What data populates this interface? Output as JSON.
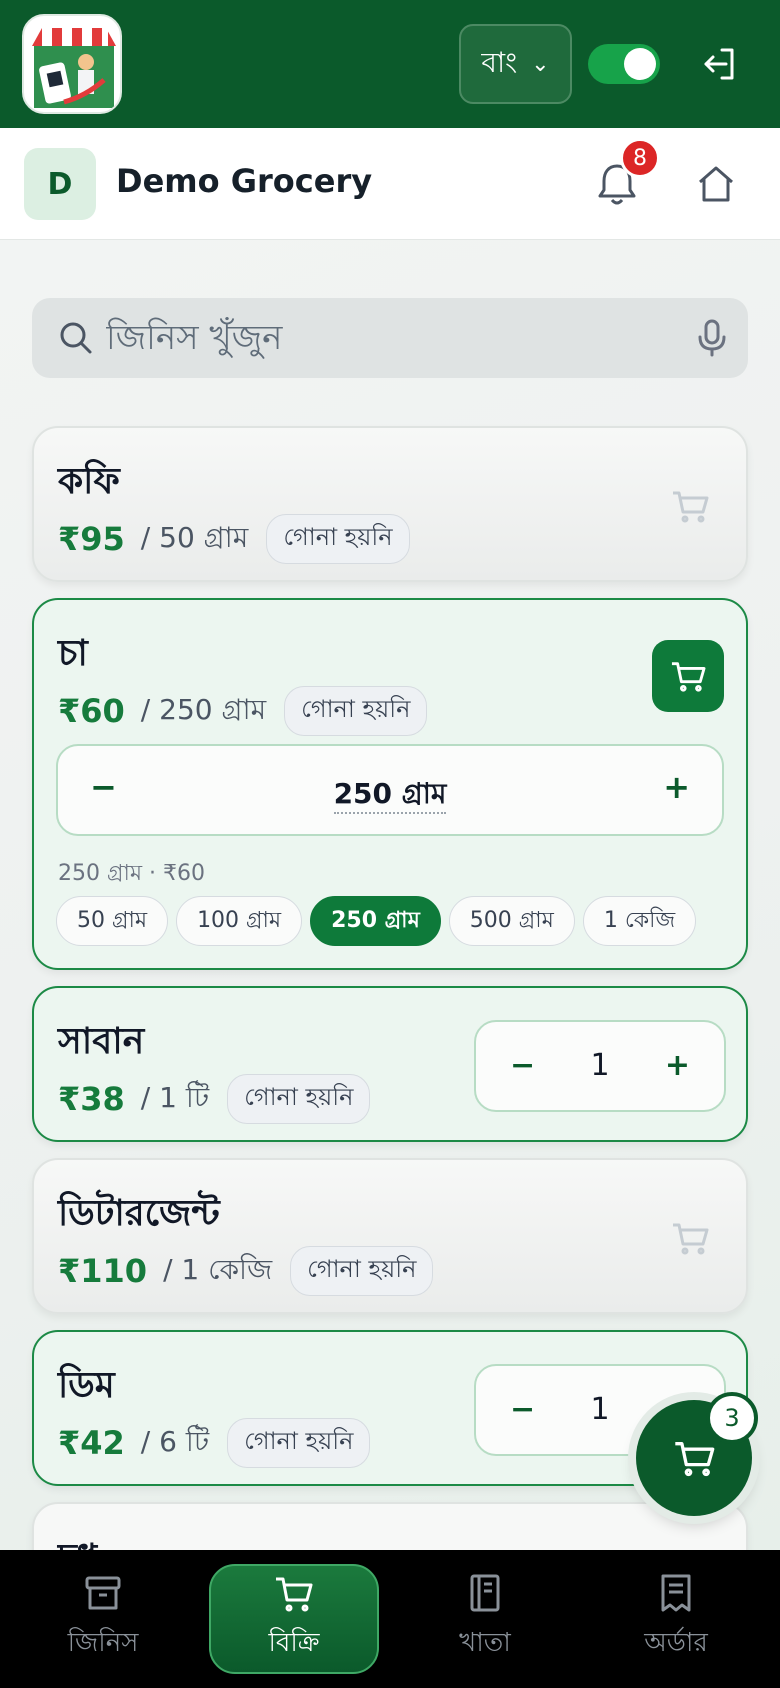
{
  "header": {
    "language": "বাং",
    "toggle_on": true
  },
  "store": {
    "initial": "D",
    "name": "Demo Grocery",
    "notification_count": "8"
  },
  "search": {
    "placeholder": "জিনিস খুঁজুন"
  },
  "products": [
    {
      "name": "কফি",
      "price": "₹95",
      "unit": "/ 50 গ্রাম",
      "tag": "গোনা হয়নি"
    },
    {
      "name": "চা",
      "price": "₹60",
      "unit": "/ 250 গ্রাম",
      "tag": "গোনা হয়নি",
      "qty": "250 গ্রাম",
      "summary": "250 গ্রাম · ₹60",
      "options": [
        "50 গ্রাম",
        "100 গ্রাম",
        "250 গ্রাম",
        "500 গ্রাম",
        "1 কেজি"
      ],
      "selected": "250 গ্রাম"
    },
    {
      "name": "সাবান",
      "price": "₹38",
      "unit": "/ 1 টি",
      "tag": "গোনা হয়নি",
      "qty": "1"
    },
    {
      "name": "ডিটারজেন্ট",
      "price": "₹110",
      "unit": "/ 1 কেজি",
      "tag": "গোনা হয়নি"
    },
    {
      "name": "ডিম",
      "price": "₹42",
      "unit": "/ 6 টি",
      "tag": "গোনা হয়নি",
      "qty": "1"
    },
    {
      "name": "দুধ"
    }
  ],
  "stepper": {
    "minus": "−",
    "plus": "+"
  },
  "cart": {
    "count": "3"
  },
  "nav": {
    "items": [
      "জিনিস",
      "বিক্রি",
      "খাতা",
      "অর্ডার"
    ],
    "active": "বিক্রি"
  },
  "colors": {
    "brand": "#0b5a2b",
    "accent": "#0e7a3a",
    "badge": "#dc2626"
  }
}
